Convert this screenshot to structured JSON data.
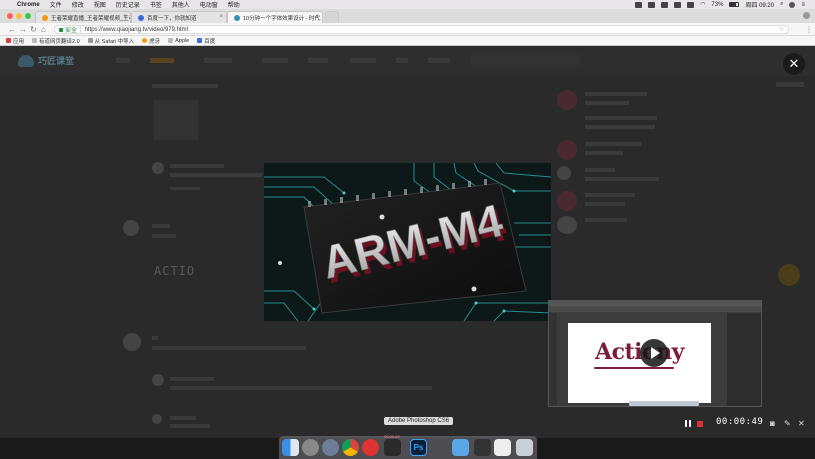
{
  "menubar": {
    "items": [
      "Chrome",
      "文件",
      "修改",
      "视图",
      "历史记录",
      "书签",
      "其他人",
      "电动窗",
      "帮助"
    ],
    "battery": "73%",
    "clock": "周四 09:20"
  },
  "tabs": [
    {
      "title": "王者荣耀直播_王者荣耀视频_王者..."
    },
    {
      "title": "百度一下，你就知道"
    },
    {
      "title": "10分钟一个字体效果设计 - 时代..."
    }
  ],
  "addressbar": {
    "secure_label": "安全",
    "url": "https://www.qiaojiang.tv/video/979.html"
  },
  "bookmarks": [
    "应用",
    "有道网页翻译2.0",
    "从 Safari 中导入",
    "虎牙",
    "Apple",
    "百度"
  ],
  "site": {
    "logo_text": "巧匠课堂",
    "sample_text": "ACTIO"
  },
  "lightbox": {
    "image_text": "ARM-M4",
    "close_glyph": "✕"
  },
  "recorder": {
    "time": "00:00:49",
    "pip_word": "Actiony"
  },
  "dock": {
    "tooltip": "Adobe Photoshop CS6",
    "recorder_badge": "00:00:49"
  },
  "colors": {
    "record_red": "#e0303a",
    "circuit_teal": "#2fb5b5",
    "pip_word": "#7a1d3a"
  }
}
